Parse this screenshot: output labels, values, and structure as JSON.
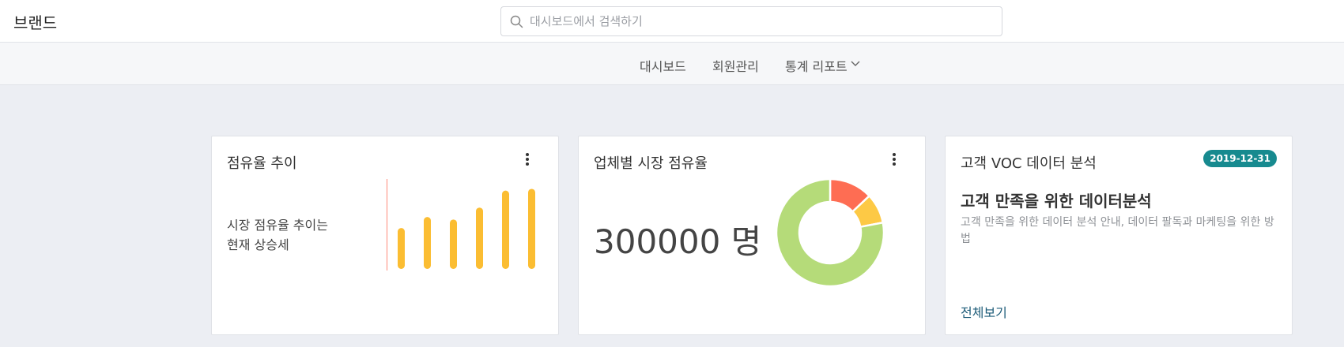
{
  "brand": "브랜드",
  "search": {
    "placeholder": "대시보드에서 검색하기",
    "value": ""
  },
  "nav": {
    "items": [
      "대시보드",
      "회원관리",
      "통계 리포트"
    ]
  },
  "cards": [
    {
      "title": "점유율 추이",
      "text_line1": "시장 점유율 추이는",
      "text_line2": "현재 상승세",
      "chart_data": {
        "type": "bar",
        "values": [
          4.8,
          6.1,
          5.8,
          7.2,
          9.2,
          9.4
        ],
        "bar_color": "#fbbd32",
        "axis_color": "#ff8b7a"
      }
    },
    {
      "title": "업체별 시장 점유율",
      "value": "300000 명",
      "chart_data": {
        "type": "pie",
        "values": [
          13,
          9,
          78
        ],
        "colors": [
          "#fe6d53",
          "#fdc945",
          "#b5db79"
        ]
      }
    },
    {
      "title": "고객 VOC 데이터 분석",
      "date_badge": "2019-12-31",
      "heading": "고객 만족을 위한 데이터분석",
      "description": "고객 만족을 위한 데이터 분석 안내, 데이터 팔독과 마케팅을 위한 방법",
      "link": "전체보기"
    }
  ],
  "colors": {
    "badge": "#178a8f",
    "link": "#1c5b78"
  },
  "icons": {
    "search": "search-icon",
    "dropdown": "chevron-down-icon",
    "menu": "more-vertical-icon"
  }
}
